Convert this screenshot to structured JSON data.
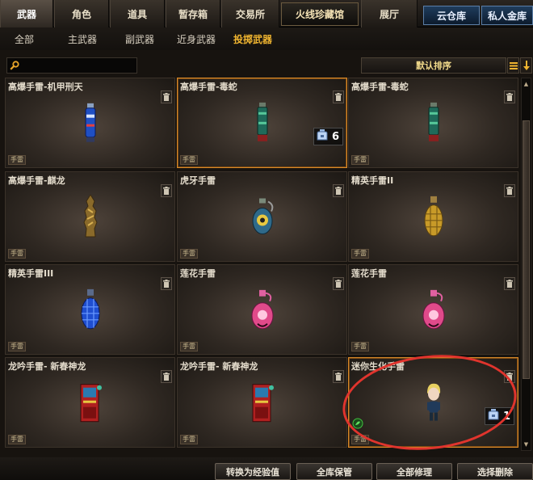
{
  "top_tabs": [
    {
      "label": "武器",
      "active": true
    },
    {
      "label": "角色"
    },
    {
      "label": "道具"
    },
    {
      "label": "暂存箱"
    },
    {
      "label": "交易所"
    },
    {
      "label": "火线珍藏馆"
    },
    {
      "label": "展厅"
    },
    {
      "label": "云仓库"
    },
    {
      "label": "私人金库"
    }
  ],
  "sub_tabs": [
    {
      "label": "全部"
    },
    {
      "label": "主武器"
    },
    {
      "label": "副武器"
    },
    {
      "label": "近身武器"
    },
    {
      "label": "投掷武器",
      "active": true
    }
  ],
  "search": {
    "value": "",
    "placeholder": ""
  },
  "sort": {
    "label": "默认排序"
  },
  "items": [
    {
      "name": "高爆手雷-机甲刑天",
      "tag": "手雷",
      "art": "blue-grenade"
    },
    {
      "name": "高爆手雷-毒蛇",
      "tag": "手雷",
      "art": "green-grenade",
      "count": "6",
      "selected": true
    },
    {
      "name": "高爆手雷-毒蛇",
      "tag": "手雷",
      "art": "green-grenade"
    },
    {
      "name": "高爆手雷-麒龙",
      "tag": "手雷",
      "art": "gold-dragon-grenade"
    },
    {
      "name": "虎牙手雷",
      "tag": "手雷",
      "art": "eye-grenade"
    },
    {
      "name": "精英手雷II",
      "tag": "手雷",
      "art": "gold-pineapple-grenade"
    },
    {
      "name": "精英手雷III",
      "tag": "手雷",
      "art": "blue-pineapple-grenade"
    },
    {
      "name": "莲花手雷",
      "tag": "手雷",
      "art": "pink-grenade"
    },
    {
      "name": "莲花手雷",
      "tag": "手雷",
      "art": "pink-grenade"
    },
    {
      "name": "龙吟手雷- 新春神龙",
      "tag": "手雷",
      "art": "red-book-grenade"
    },
    {
      "name": "龙吟手雷- 新春神龙",
      "tag": "手雷",
      "art": "red-book-grenade"
    },
    {
      "name": "迷你生化手雷",
      "tag": "手雷",
      "art": "mini-character",
      "count": "1",
      "selected": true,
      "circled": true
    }
  ],
  "bottom_buttons": [
    {
      "label": "转换为经验值"
    },
    {
      "label": "全库保管"
    },
    {
      "label": "全部修理"
    },
    {
      "label": "选择删除"
    }
  ],
  "colors": {
    "active_sub_tab": "#f0b530",
    "selection_border": "#d98a2a",
    "annotation_circle": "#e0342d"
  }
}
